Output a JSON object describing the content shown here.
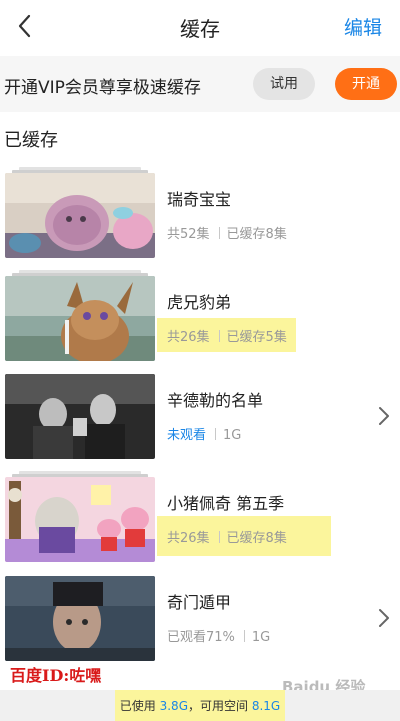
{
  "header": {
    "title": "缓存",
    "edit_label": "编辑"
  },
  "vip": {
    "text": "开通VIP会员尊享极速缓存",
    "try_label": "试用",
    "open_label": "开通"
  },
  "section_title": "已缓存",
  "items": [
    {
      "title": "瑞奇宝宝",
      "total": "共52集",
      "status": "已缓存8集"
    },
    {
      "title": "虎兄豹弟",
      "total": "共26集",
      "status": "已缓存5集"
    },
    {
      "title": "辛德勒的名单",
      "watch": "未观看",
      "size": "1G"
    },
    {
      "title": "小猪佩奇 第五季",
      "total": "共26集",
      "status": "已缓存8集"
    },
    {
      "title": "奇门遁甲",
      "watch": "已观看71%",
      "size": "1G"
    }
  ],
  "watermark": "百度ID:咗嘿",
  "baidu_watermark": "Baidu 经验",
  "footer": {
    "used_label": "已使用",
    "used": "3.8G",
    "mid": "，可用空间",
    "free": "8.1G"
  },
  "colors": {
    "accent": "#1a86e6",
    "vip_button": "#ff6f15",
    "highlight": "#fbf59c"
  }
}
